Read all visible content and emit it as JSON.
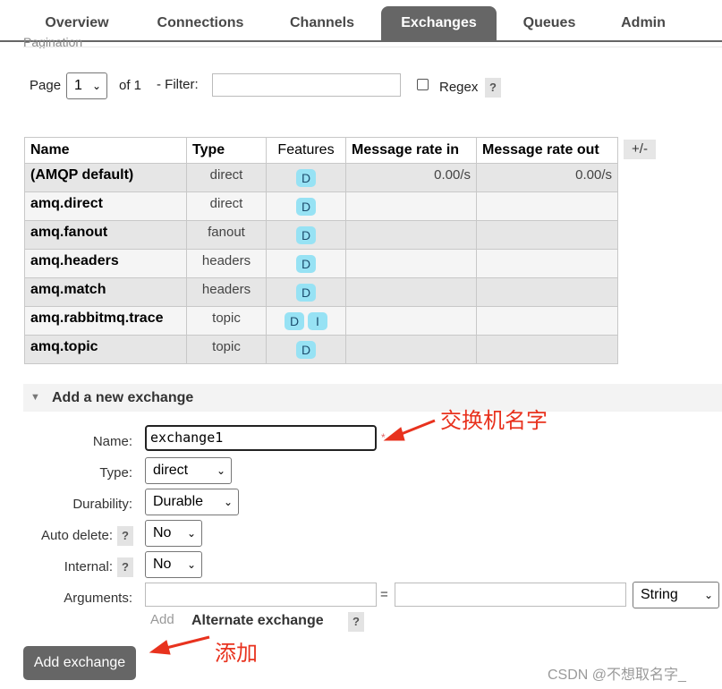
{
  "nav": {
    "tabs": [
      {
        "label": "Overview"
      },
      {
        "label": "Connections"
      },
      {
        "label": "Channels"
      },
      {
        "label": "Exchanges"
      },
      {
        "label": "Queues"
      },
      {
        "label": "Admin"
      }
    ],
    "active": "Exchanges"
  },
  "pagination": {
    "section_label": "Pagination",
    "page_label": "Page",
    "page_value": "1",
    "of_label": "of 1",
    "filter_label": "- Filter:",
    "filter_value": "",
    "regex_label": "Regex",
    "regex_checked": false,
    "help": "?"
  },
  "table": {
    "columns": [
      "Name",
      "Type",
      "Features",
      "Message rate in",
      "Message rate out"
    ],
    "toggle_label": "+/-",
    "rows": [
      {
        "name": "(AMQP default)",
        "type": "direct",
        "features": [
          "D"
        ],
        "rate_in": "0.00/s",
        "rate_out": "0.00/s"
      },
      {
        "name": "amq.direct",
        "type": "direct",
        "features": [
          "D"
        ],
        "rate_in": "",
        "rate_out": ""
      },
      {
        "name": "amq.fanout",
        "type": "fanout",
        "features": [
          "D"
        ],
        "rate_in": "",
        "rate_out": ""
      },
      {
        "name": "amq.headers",
        "type": "headers",
        "features": [
          "D"
        ],
        "rate_in": "",
        "rate_out": ""
      },
      {
        "name": "amq.match",
        "type": "headers",
        "features": [
          "D"
        ],
        "rate_in": "",
        "rate_out": ""
      },
      {
        "name": "amq.rabbitmq.trace",
        "type": "topic",
        "features": [
          "D",
          "I"
        ],
        "rate_in": "",
        "rate_out": ""
      },
      {
        "name": "amq.topic",
        "type": "topic",
        "features": [
          "D"
        ],
        "rate_in": "",
        "rate_out": ""
      }
    ]
  },
  "add_exchange": {
    "title": "Add a new exchange",
    "name_label": "Name:",
    "name_value": "exchange1",
    "required_mark": "*",
    "type_label": "Type:",
    "type_value": "direct",
    "durability_label": "Durability:",
    "durability_value": "Durable",
    "auto_delete_label": "Auto delete:",
    "auto_delete_value": "No",
    "internal_label": "Internal:",
    "internal_value": "No",
    "arguments_label": "Arguments:",
    "arg_key": "",
    "arg_equals": "=",
    "arg_value": "",
    "arg_type": "String",
    "add_link": "Add",
    "alternate_exchange": "Alternate exchange",
    "help": "?",
    "submit": "Add exchange"
  },
  "annotations": {
    "name_note": "交换机名字",
    "button_note": "添加",
    "color": "#e8321e"
  },
  "watermark": "CSDN @不想取名字_",
  "colors": {
    "nav_active": "#666666",
    "badge": "#97e2f4",
    "button": "#666666"
  }
}
